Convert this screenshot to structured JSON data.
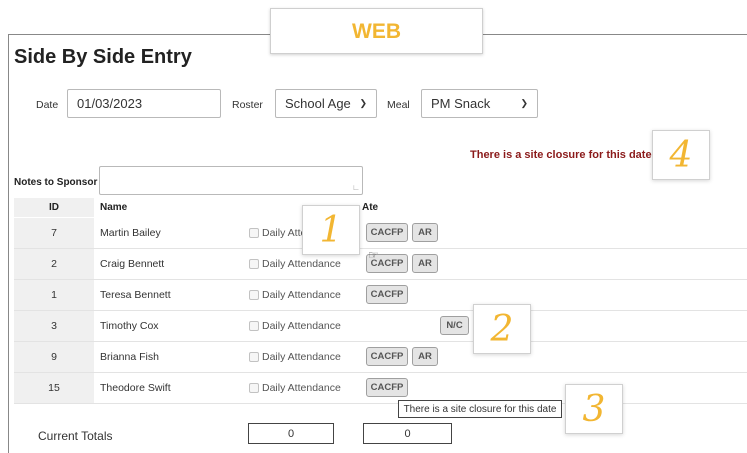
{
  "badge": {
    "label": "WEB"
  },
  "page": {
    "title": "Side By Side Entry"
  },
  "filters": {
    "date_label": "Date",
    "date_value": "01/03/2023",
    "roster_label": "Roster",
    "roster_value": "School Age",
    "meal_label": "Meal",
    "meal_value": "PM Snack"
  },
  "closure": {
    "message": "There is a site closure for this date"
  },
  "callouts": [
    "1",
    "2",
    "3",
    "4"
  ],
  "notes": {
    "label": "Notes to Sponsor",
    "value": ""
  },
  "table": {
    "headers": {
      "id": "ID",
      "name": "Name",
      "ate": "Ate"
    },
    "attendance_label": "Daily Attendance",
    "rows": [
      {
        "id": "7",
        "name": "Martin Bailey",
        "buttons": [
          "CACFP",
          "AR"
        ]
      },
      {
        "id": "2",
        "name": "Craig Bennett",
        "buttons": [
          "CACFP",
          "AR"
        ]
      },
      {
        "id": "1",
        "name": "Teresa Bennett",
        "buttons": [
          "CACFP"
        ]
      },
      {
        "id": "3",
        "name": "Timothy Cox",
        "buttons": [
          "N/C"
        ]
      },
      {
        "id": "9",
        "name": "Brianna Fish",
        "buttons": [
          "CACFP",
          "AR"
        ]
      },
      {
        "id": "15",
        "name": "Theodore Swift",
        "buttons": [
          "CACFP"
        ]
      }
    ]
  },
  "tooltip": {
    "text": "There is a site closure for this date"
  },
  "totals": {
    "label": "Current Totals",
    "attendance": "0",
    "ate": "0"
  },
  "colors": {
    "accent": "#f2b632",
    "closure_text": "#8b1a1a"
  }
}
